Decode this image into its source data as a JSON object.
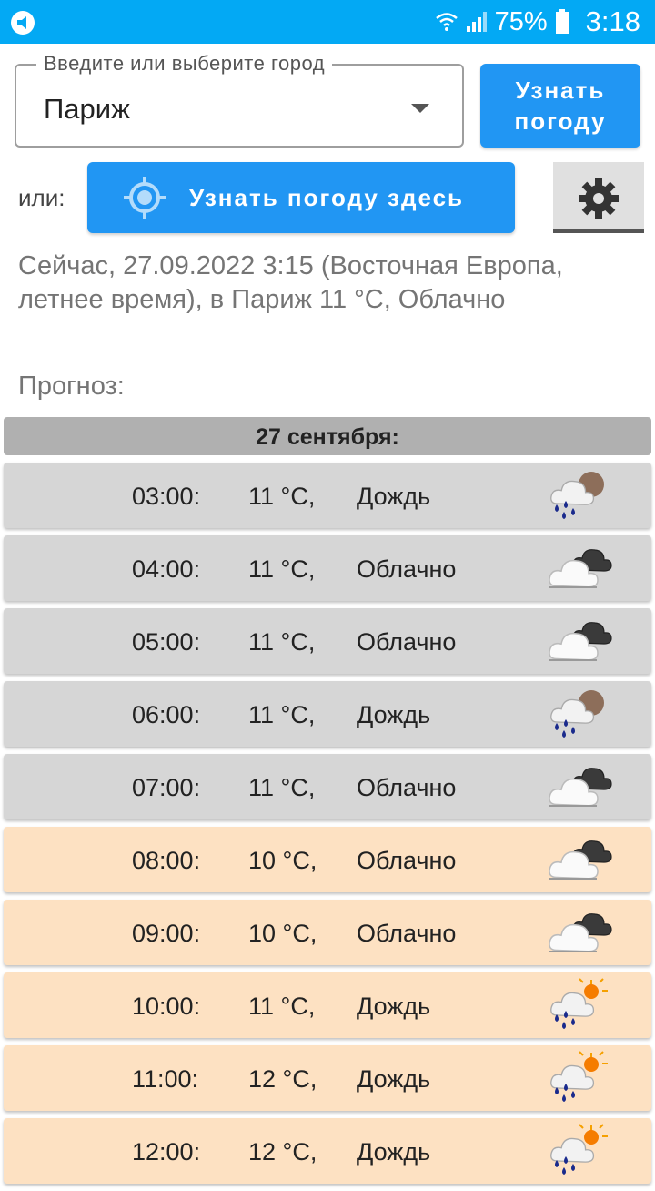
{
  "status_bar": {
    "battery": "75%",
    "time": "3:18",
    "icons": [
      "app-notification-icon",
      "wifi-icon",
      "signal-icon",
      "battery-icon"
    ]
  },
  "city": {
    "label": "Введите или выберите город",
    "value": "Париж"
  },
  "buttons": {
    "get_weather": "Узнать погоду",
    "or": "или:",
    "weather_here": "Узнать погоду здесь"
  },
  "now": "Сейчас, 27.09.2022 3:15 (Восточная Европа, летнее время), в Париж 11 °C, Облачно",
  "forecast_label": "Прогноз:",
  "day_header": "27 сентября:",
  "rows": [
    {
      "time": "03:00:",
      "temp": "11 °C,",
      "desc": "Дождь",
      "icon": "rain-night",
      "period": "night"
    },
    {
      "time": "04:00:",
      "temp": "11 °C,",
      "desc": "Облачно",
      "icon": "cloudy",
      "period": "night"
    },
    {
      "time": "05:00:",
      "temp": "11 °C,",
      "desc": "Облачно",
      "icon": "cloudy",
      "period": "night"
    },
    {
      "time": "06:00:",
      "temp": "11 °C,",
      "desc": "Дождь",
      "icon": "rain-night",
      "period": "night"
    },
    {
      "time": "07:00:",
      "temp": "11 °C,",
      "desc": "Облачно",
      "icon": "cloudy",
      "period": "night"
    },
    {
      "time": "08:00:",
      "temp": "10 °C,",
      "desc": "Облачно",
      "icon": "cloudy",
      "period": "day"
    },
    {
      "time": "09:00:",
      "temp": "10 °C,",
      "desc": "Облачно",
      "icon": "cloudy",
      "period": "day"
    },
    {
      "time": "10:00:",
      "temp": "11 °C,",
      "desc": "Дождь",
      "icon": "rain-day",
      "period": "day"
    },
    {
      "time": "11:00:",
      "temp": "12 °C,",
      "desc": "Дождь",
      "icon": "rain-day",
      "period": "day"
    },
    {
      "time": "12:00:",
      "temp": "12 °C,",
      "desc": "Дождь",
      "icon": "rain-day",
      "period": "day"
    }
  ],
  "colors": {
    "status_bar": "#03A9F4",
    "accent": "#2196F3",
    "night_row": "#d6d6d6",
    "day_row": "#fde1c2"
  }
}
